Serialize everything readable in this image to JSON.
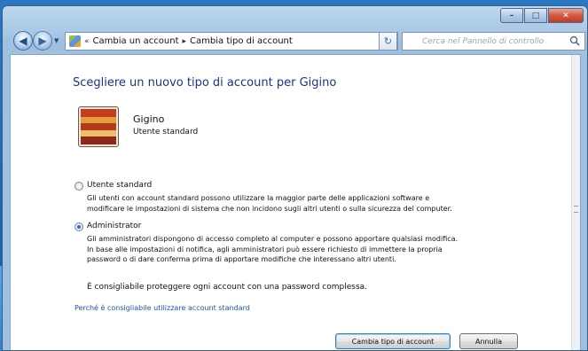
{
  "window": {
    "caption_buttons": {
      "minimize": "–",
      "maximize": "□",
      "close": "✕"
    }
  },
  "nav": {
    "back_icon": "◀",
    "forward_icon": "▶",
    "dropdown_icon": "▼",
    "breadcrumb": [
      "«",
      "Cambia un account",
      "▸",
      "Cambia tipo di account"
    ],
    "refresh_icon": "↻",
    "search_placeholder": "Cerca nel Pannello di controllo"
  },
  "main": {
    "title": "Scegliere un nuovo tipo di account per Gigino",
    "user": {
      "name": "Gigino",
      "type": "Utente standard"
    },
    "options": [
      {
        "label": "Utente standard",
        "selected": false,
        "description": [
          "Gli utenti con account standard possono utilizzare la maggior parte delle applicazioni software e",
          "modificare le impostazioni di sistema che non incidono sugli altri utenti o sulla sicurezza del computer."
        ]
      },
      {
        "label": "Administrator",
        "selected": true,
        "description": [
          "Gli amministratori dispongono di accesso completo al computer e possono apportare qualsiasi modifica.",
          "In base alle impostazioni di notifica, agli amministratori può essere richiesto di immettere la propria",
          "password o di dare conferma prima di apportare modifiche che interessano altri utenti."
        ]
      }
    ],
    "advice": "È consigliabile proteggere ogni account con una password complessa.",
    "help_link": "Perché è consigliabile utilizzare account standard",
    "buttons": {
      "change": "Cambia tipo di account",
      "cancel": "Annulla"
    }
  }
}
